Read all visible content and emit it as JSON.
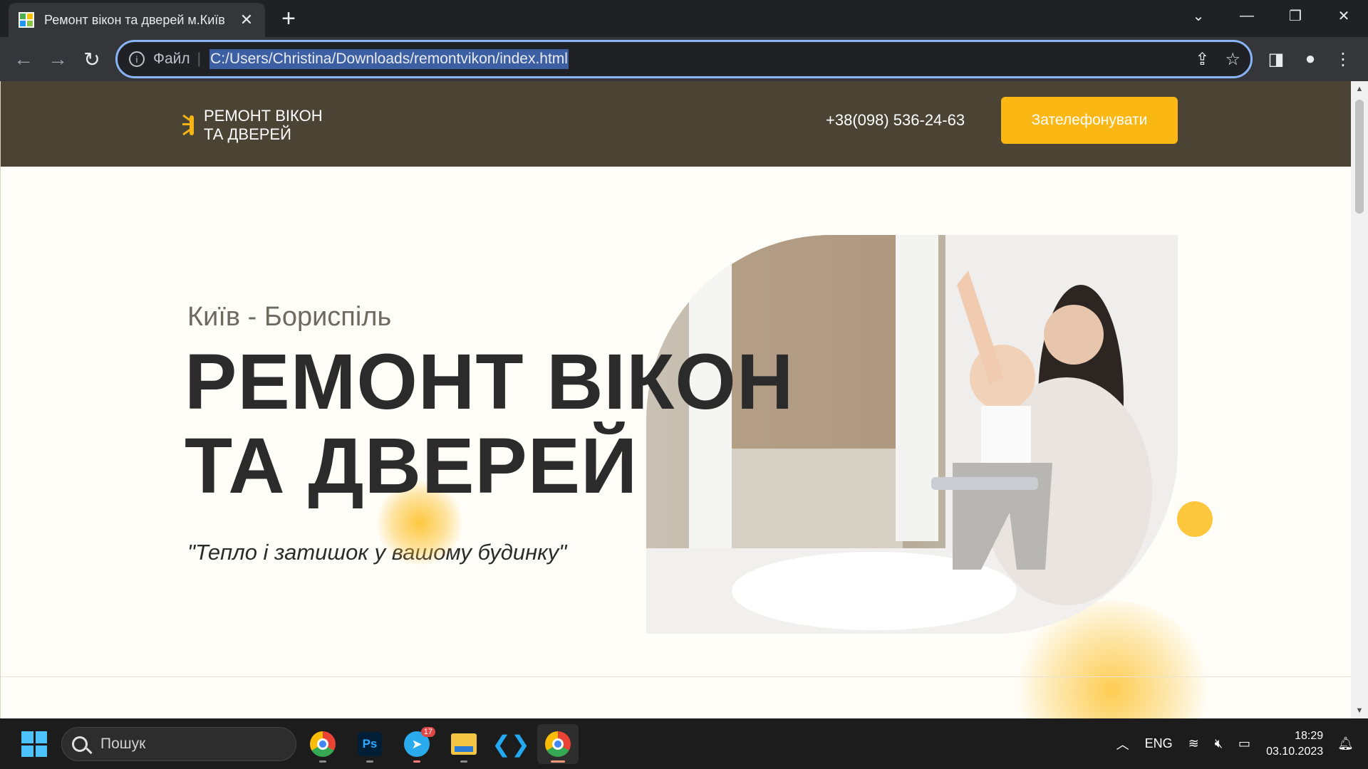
{
  "browser": {
    "tab_title": "Ремонт вікон та дверей м.Київ",
    "address_label": "Файл",
    "url": "C:/Users/Christina/Downloads/remontvikon/index.html"
  },
  "site": {
    "logo_line1": "РЕМОНТ ВІКОН",
    "logo_line2": "ТА ДВЕРЕЙ",
    "phone": "+38(098) 536-24-63",
    "call_button": "Зателефонувати",
    "hero_city": "Київ - Бориспіль",
    "hero_title_line1": "РЕМОНТ ВІКОН",
    "hero_title_line2": "ТА ДВЕРЕЙ",
    "hero_quote": "\"Тепло і затишок у вашому будинку\"",
    "accent_color": "#fbb714",
    "header_color": "#4b4334"
  },
  "taskbar": {
    "search_placeholder": "Пошук",
    "telegram_badge": "17",
    "language": "ENG",
    "time": "18:29",
    "date": "03.10.2023"
  }
}
